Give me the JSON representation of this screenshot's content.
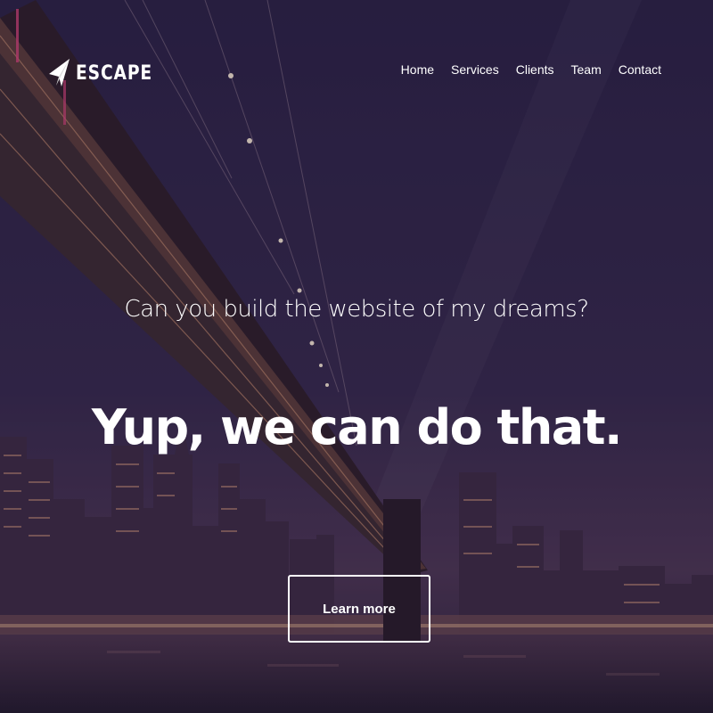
{
  "brand": {
    "name": "ESCAPE",
    "logo_icon": "paper-plane-icon"
  },
  "nav": {
    "items": [
      {
        "label": "Home"
      },
      {
        "label": "Services"
      },
      {
        "label": "Clients"
      },
      {
        "label": "Team"
      },
      {
        "label": "Contact"
      }
    ]
  },
  "hero": {
    "tagline": "Can you build the website of my dreams?",
    "headline": "Yup, we can do that.",
    "cta_label": "Learn more",
    "background": "night-city-bridge-photo",
    "colors": {
      "sky": "#2a2342",
      "text": "#ffffff"
    }
  }
}
